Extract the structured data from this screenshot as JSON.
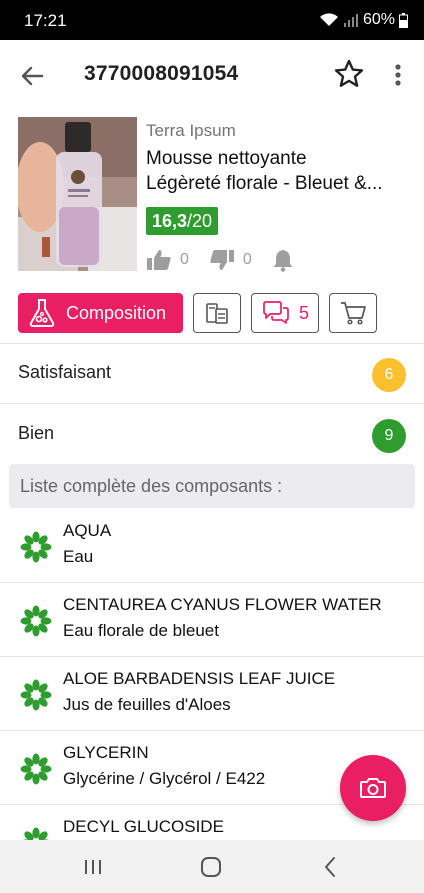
{
  "status_bar": {
    "time": "17:21",
    "battery": "60%"
  },
  "app_bar": {
    "title": "3770008091054"
  },
  "product": {
    "brand": "Terra Ipsum",
    "name_line1": "Mousse nettoyante",
    "name_line2": "Légèreté florale - Bleuet &...",
    "score": "16,3",
    "score_max": "/20",
    "likes": "0",
    "dislikes": "0"
  },
  "tabs": {
    "composition_label": "Composition",
    "reviews_count": "5"
  },
  "ratings": [
    {
      "label": "Satisfaisant",
      "count": "6",
      "color": "#fbc02d"
    },
    {
      "label": "Bien",
      "count": "9",
      "color": "#2e9c2e"
    }
  ],
  "ingredients_header": "Liste complète des composants :",
  "ingredients": [
    {
      "inci": "AQUA",
      "common": "Eau"
    },
    {
      "inci": "CENTAUREA CYANUS FLOWER WATER",
      "common": "Eau florale de bleuet"
    },
    {
      "inci": "ALOE BARBADENSIS LEAF JUICE",
      "common": "Jus de feuilles d'Aloes"
    },
    {
      "inci": "GLYCERIN",
      "common": "Glycérine / Glycérol / E422"
    },
    {
      "inci": "DECYL GLUCOSIDE",
      "common": ""
    }
  ],
  "colors": {
    "accent": "#e91e63",
    "score_green": "#2e9c2e",
    "ingredient_icon": "#2e9c2e"
  },
  "icons": {
    "back": "arrow-left-icon",
    "favorite": "star-outline-icon",
    "menu": "more-vert-icon",
    "like": "thumb-up-icon",
    "dislike": "thumb-down-icon",
    "notify": "bell-icon",
    "composition": "flask-icon",
    "compare": "compare-icon",
    "reviews": "chat-bubbles-icon",
    "cart": "cart-icon",
    "camera": "camera-icon",
    "ingredient": "flower-icon"
  }
}
